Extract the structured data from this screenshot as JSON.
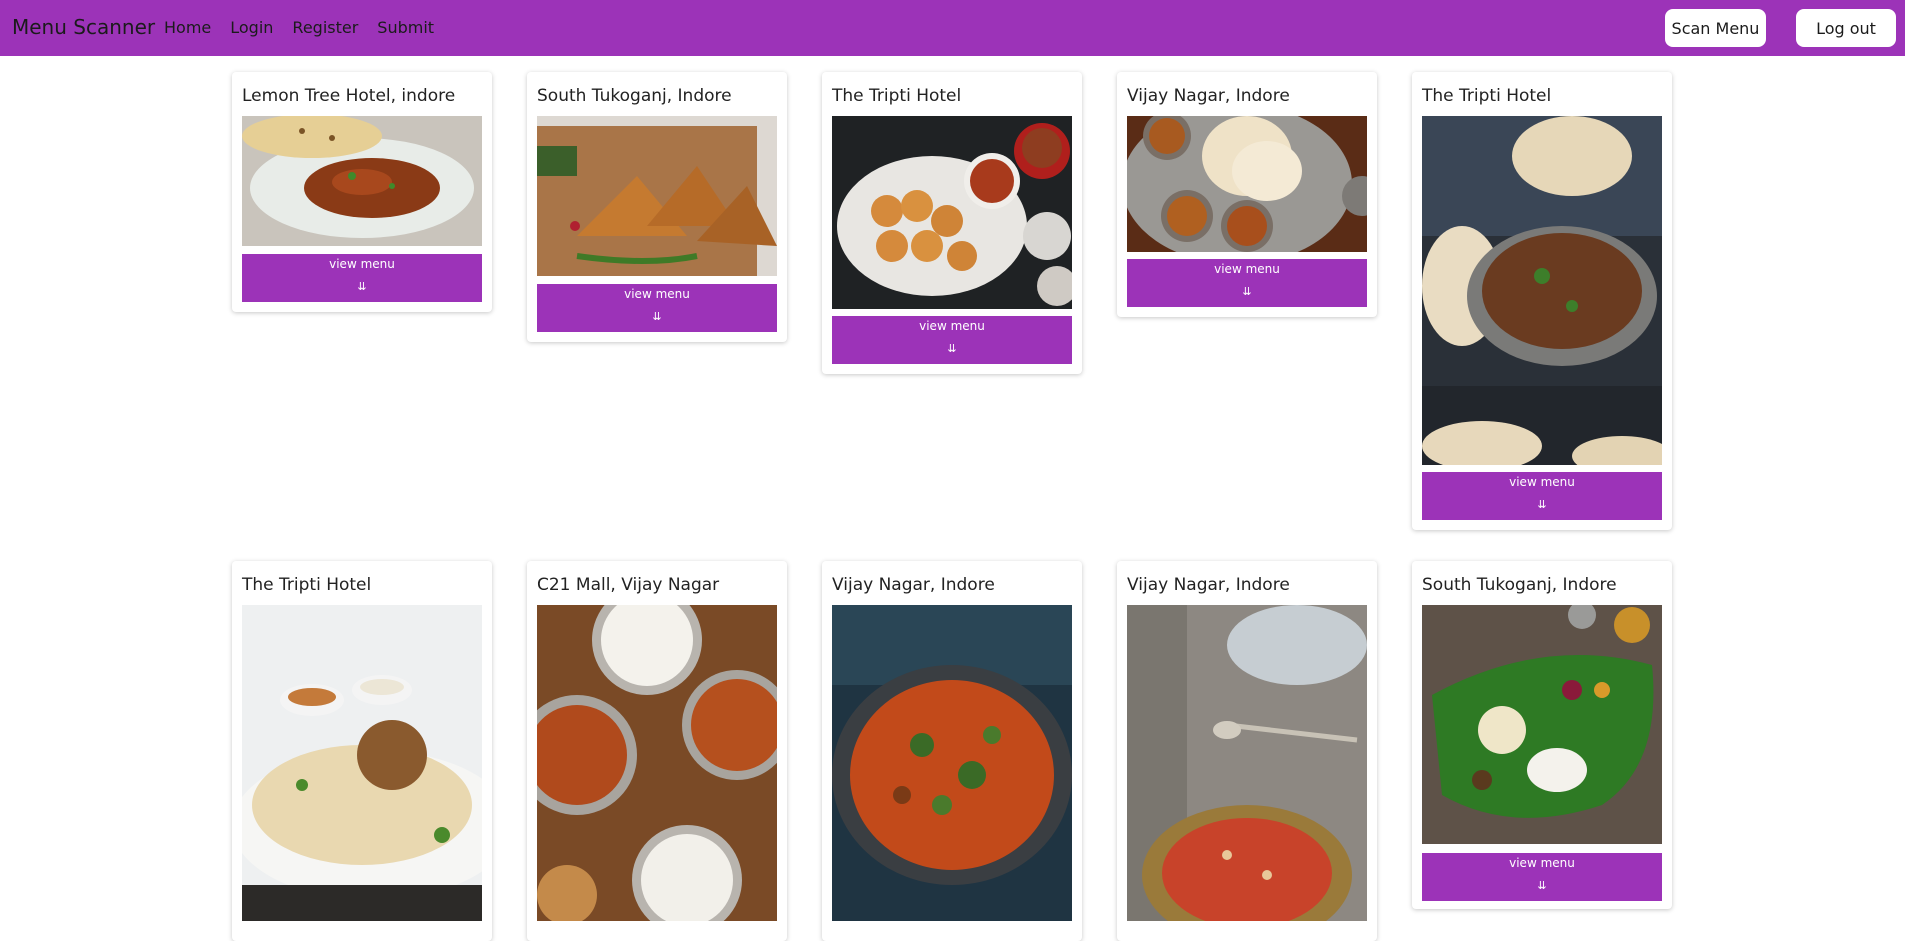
{
  "navbar": {
    "brand": "Menu Scanner",
    "links": [
      "Home",
      "Login",
      "Register",
      "Submit"
    ],
    "scan_button": "Scan Menu",
    "logout_button": "Log out"
  },
  "colors": {
    "accent": "#9c33b8",
    "card_button": "#9c33b8"
  },
  "view_menu_label": "view menu",
  "chevron_icon": "double-chevron-down-icon",
  "cards": [
    {
      "title": "Lemon Tree Hotel, indore",
      "image": "butter-chicken-naan"
    },
    {
      "title": "South Tukoganj, Indore",
      "image": "samosa-plate"
    },
    {
      "title": "The Tripti Hotel",
      "image": "pav-bhaji"
    },
    {
      "title": "Vijay Nagar, Indore",
      "image": "thali-papad"
    },
    {
      "title": "The Tripti Hotel",
      "image": "curry-kadai-naan"
    },
    {
      "title": "The Tripti Hotel",
      "image": "biryani-plate"
    },
    {
      "title": " C21 Mall, Vijay Nagar",
      "image": "curry-bowls-rice"
    },
    {
      "title": " Vijay Nagar, Indore",
      "image": "curry-pan"
    },
    {
      "title": "Vijay Nagar, Indore",
      "image": "halwa-bowl"
    },
    {
      "title": "South Tukoganj, Indore",
      "image": "banana-leaf-meal"
    }
  ]
}
